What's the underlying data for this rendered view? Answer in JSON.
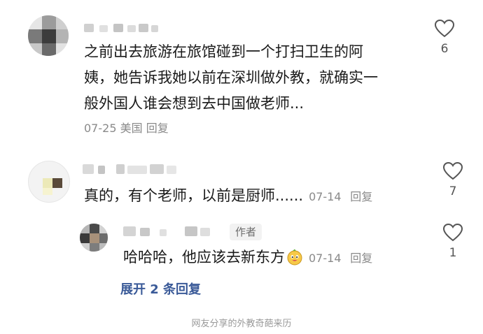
{
  "comments": [
    {
      "text_line1": "之前出去旅游在旅馆碰到一个打扫卫生的阿",
      "text_line2": "姨，她告诉我她以前在深圳做外教，就确实一",
      "text_line3": "般外国人谁会想到去中国做老师...",
      "date": "07-25",
      "location": "美国",
      "reply_label": "回复",
      "likes": "6"
    },
    {
      "text": "真的，有个老师，以前是厨师......",
      "date": "07-14",
      "reply_label": "回复",
      "likes": "7"
    },
    {
      "author_badge": "作者",
      "text": "哈哈哈，他应该去新东方",
      "emoji_icon": "smiling-face-emoji",
      "date": "07-14",
      "reply_label": "回复",
      "likes": "1"
    }
  ],
  "expand_replies": "展开 2 条回复",
  "caption": "网友分享的外教奇葩来历",
  "icons": {
    "like": "heart-outline-icon"
  },
  "colors": {
    "link": "#3a5a98",
    "meta": "#8a8a8a"
  }
}
